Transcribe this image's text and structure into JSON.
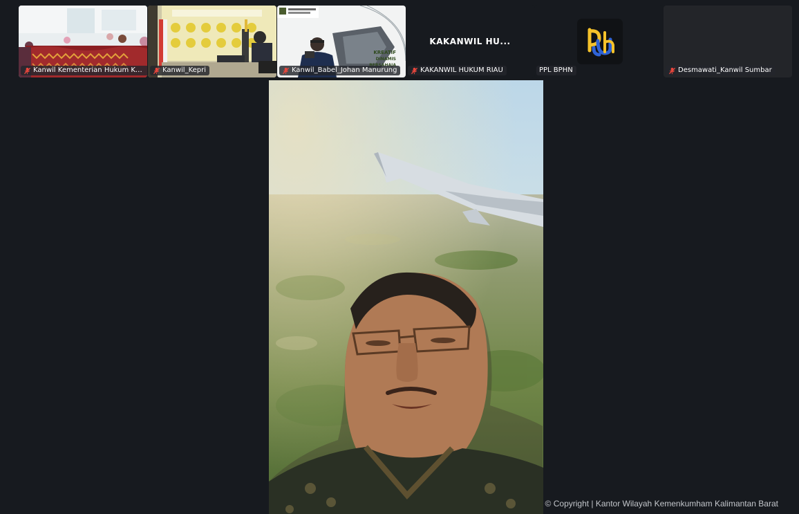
{
  "participants": [
    {
      "name": "Kanwil Kementerian Hukum Kalb...",
      "muted": true
    },
    {
      "name": "Kanwil_Kepri",
      "muted": true
    },
    {
      "name": "Kanwil_Babel_Johan Manurung",
      "muted": true
    },
    {
      "name": "KAKANWIL HUKUM RIAU",
      "muted": true,
      "video_off_label": "KAKANWIL HU..."
    },
    {
      "name": "PPL BPHN",
      "muted": false,
      "avatar_text": "bph"
    },
    {
      "name": "Desmawati_Kanwil Sumbar",
      "muted": true
    }
  ],
  "tile3_banner": {
    "line1": "KREATIF",
    "line2": "DINAMIS",
    "line3": "BERSAHAJA"
  },
  "footer": {
    "copyright": "© Copyright | Kantor Wilayah Kemenkumham Kalimantan Barat"
  },
  "colors": {
    "background": "#171a1f",
    "tile_gray": "#232529",
    "muted_icon": "#e8463c",
    "logo_yellow": "#f5c22a",
    "logo_blue": "#2f63d6"
  }
}
